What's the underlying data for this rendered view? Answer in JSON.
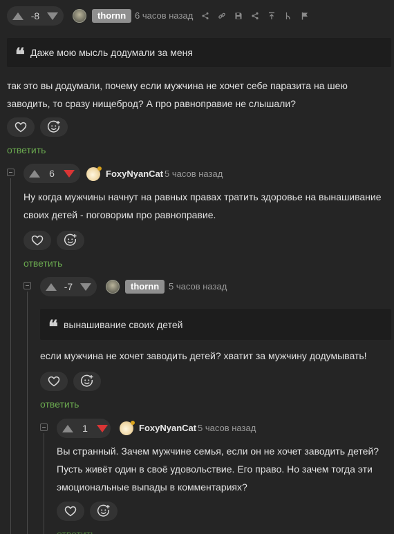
{
  "comments": [
    {
      "score": "-8",
      "author": "thornn",
      "time": "6 часов назад",
      "quote": "Даже мою мысль додумали за меня",
      "text": "так это вы додумали, почему если мужчина не хочет себе паразита на шею заводить, то сразу нищеброд? А про равноправие не слышали?",
      "reply": "ответить",
      "tools": [
        "share-nodes-icon",
        "link-icon",
        "save-icon",
        "share-icon",
        "to-top-icon",
        "branch-icon",
        "flag-icon"
      ]
    },
    {
      "score": "6",
      "author": "FoxyNyanCat",
      "time": "5 часов назад",
      "text": "Ну когда мужчины начнут на равных правах тратить здоровье на вынашивание своих детей - поговорим про равноправие.",
      "reply": "ответить"
    },
    {
      "score": "-7",
      "author": "thornn",
      "time": "5 часов назад",
      "quote": "вынашивание своих детей",
      "text": "если мужчина не хочет заводить детей? хватит за мужчину додумывать!",
      "reply": "ответить"
    },
    {
      "score": "1",
      "author": "FoxyNyanCat",
      "time": "5 часов назад",
      "text": "Вы странный. Зачем мужчине семья, если он не хочет заводить детей? Пусть живёт один в своё удовольствие. Его право. Но зачем тогда эти эмоциональные выпады в комментариях?",
      "reply": "ответить"
    }
  ],
  "colors": {
    "background": "#252525",
    "pill": "#333333",
    "quote_bg": "#1d1d1d",
    "reply_green": "#6aa84f",
    "downvote_active": "#d93535",
    "online": "#d9a21b"
  }
}
